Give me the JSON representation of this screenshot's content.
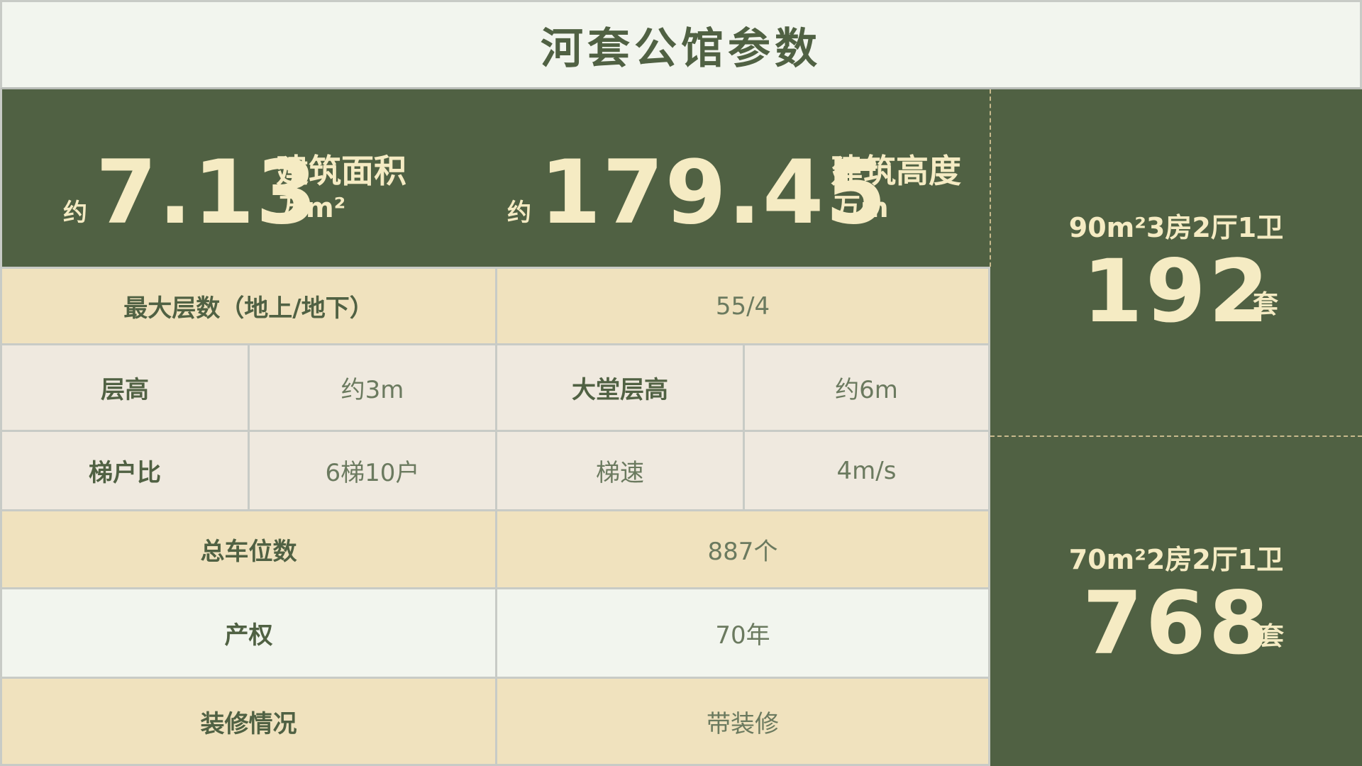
{
  "title": "河套公馆参数",
  "stats": [
    {
      "prefix": "约",
      "value": "7.13",
      "label": "建筑面积",
      "unit": "万m²"
    },
    {
      "prefix": "约",
      "value": "179.45",
      "label": "建筑高度",
      "unit": "万m"
    }
  ],
  "unit_types": [
    {
      "type": "90m²3房2厅1卫",
      "count": "192",
      "suffix": "套"
    },
    {
      "type": "70m²2房2厅1卫",
      "count": "768",
      "suffix": "套"
    }
  ],
  "table": {
    "max_floors": {
      "label": "最大层数（地上/地下）",
      "value": "55/4"
    },
    "floor_height": {
      "label": "层高",
      "value": "约3m"
    },
    "lobby_height": {
      "label": "大堂层高",
      "value": "约6m"
    },
    "elevator_ratio": {
      "label": "梯户比",
      "value": "6梯10户"
    },
    "elevator_speed": {
      "label": "梯速",
      "value": "4m/s"
    },
    "parking": {
      "label": "总车位数",
      "value": "887个"
    },
    "ownership": {
      "label": "产权",
      "value": "70年"
    },
    "decoration": {
      "label": "装修情况",
      "value": "带装修"
    }
  },
  "colors": {
    "primary_green": "#506143",
    "cream_text": "#f5ebc3",
    "beige_row": "#f0e2be",
    "gray_row": "#efe9df",
    "light_bg": "#f2f5ee"
  }
}
